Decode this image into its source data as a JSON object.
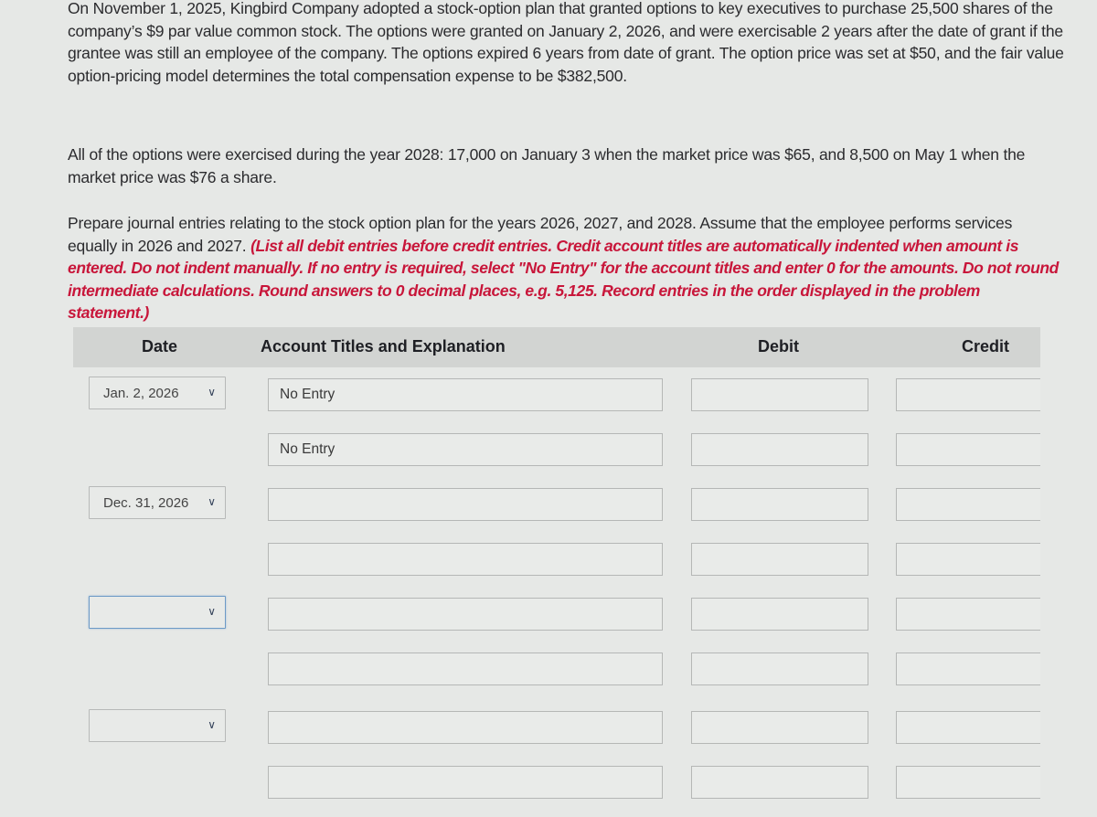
{
  "problem": {
    "paragraph1": "On November 1, 2025, Kingbird Company adopted a stock-option plan that granted options to key executives to purchase 25,500 shares of the company’s $9 par value common stock. The options were granted on January 2, 2026, and were exercisable 2 years after the date of grant if the grantee was still an employee of the company. The options expired 6 years from date of grant. The option price was set at $50, and the fair value option-pricing model determines the total compensation expense to be $382,500.",
    "paragraph2": "All of the options were exercised during the year 2028: 17,000 on January 3 when the market price was $65, and 8,500 on May 1 when the market price was $76 a share.",
    "paragraph3_plain": "Prepare journal entries relating to the stock option plan for the years 2026, 2027, and 2028. Assume that the employee performs services equally in 2026 and 2027. ",
    "paragraph3_instructions": "(List all debit entries before credit entries. Credit account titles are automatically indented when amount is entered. Do not indent manually. If no entry is required, select \"No Entry\" for the account titles and enter 0 for the amounts. Do not round intermediate calculations. Round answers to 0 decimal places, e.g. 5,125. Record entries in the order displayed in the problem statement.)"
  },
  "table": {
    "headers": {
      "date": "Date",
      "account": "Account Titles and Explanation",
      "debit": "Debit",
      "credit": "Credit"
    },
    "rows": [
      {
        "date": "Jan. 2, 2026",
        "account": "No Entry",
        "debit": "",
        "credit": ""
      },
      {
        "date": null,
        "account": "No Entry",
        "debit": "",
        "credit": ""
      },
      {
        "date": "Dec. 31, 2026",
        "account": "",
        "debit": "",
        "credit": ""
      },
      {
        "date": null,
        "account": "",
        "debit": "",
        "credit": ""
      },
      {
        "date": "",
        "account": "",
        "debit": "",
        "credit": ""
      },
      {
        "date": null,
        "account": "",
        "debit": "",
        "credit": ""
      },
      {
        "date": "",
        "account": "",
        "debit": "",
        "credit": ""
      },
      {
        "date": null,
        "account": "",
        "debit": "",
        "credit": ""
      }
    ]
  },
  "icons": {
    "dropdown": "chevron-down-icon"
  },
  "colors": {
    "instruction_red": "#c8163a",
    "focus_blue": "#6d9ac6",
    "header_bg": "#d2d4d2"
  }
}
